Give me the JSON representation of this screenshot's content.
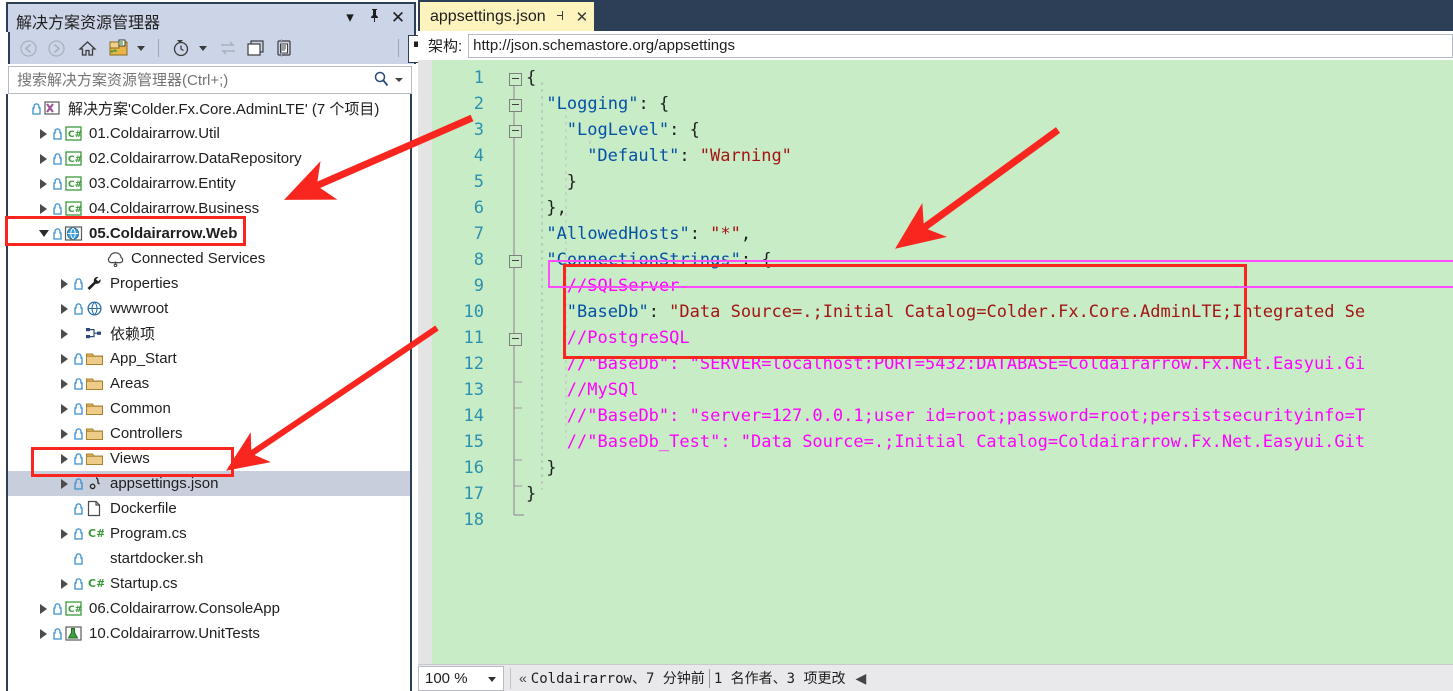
{
  "solution_explorer": {
    "title": "解决方案资源管理器",
    "header_buttons": [
      {
        "name": "dropdown",
        "glyph": "▾"
      },
      {
        "name": "pin",
        "glyph": "⇟"
      },
      {
        "name": "close",
        "glyph": "✕"
      }
    ],
    "toolbar": [
      {
        "name": "back",
        "title": "后退"
      },
      {
        "name": "forward",
        "title": "前进"
      },
      {
        "name": "home",
        "title": "主页"
      },
      {
        "name": "new-folder",
        "title": "新建文件夹"
      },
      {
        "name": "pending-changes",
        "title": "挂起的更改"
      },
      {
        "name": "sync",
        "title": "同步"
      },
      {
        "name": "properties-window",
        "title": "属性窗口"
      },
      {
        "name": "show-all-files",
        "title": "显示所有文件"
      },
      {
        "name": "view-designer",
        "title": "视图设计器"
      },
      {
        "name": "wrench",
        "title": "工具"
      },
      {
        "name": "collapse",
        "title": "全部折叠"
      }
    ],
    "search": {
      "placeholder": "搜索解决方案资源管理器(Ctrl+;)",
      "value": ""
    },
    "tree": [
      {
        "label": "解决方案'Colder.Fx.Core.AdminLTE' (7 个项目)",
        "indent": 0,
        "twisty": "none",
        "icon": "solution-icon",
        "lock": true,
        "bold": false,
        "selected": false
      },
      {
        "label": "01.Coldairarrow.Util",
        "indent": 1,
        "twisty": "right",
        "icon": "csharp-project-icon",
        "lock": true,
        "bold": false,
        "selected": false
      },
      {
        "label": "02.Coldairarrow.DataRepository",
        "indent": 1,
        "twisty": "right",
        "icon": "csharp-project-icon",
        "lock": true,
        "bold": false,
        "selected": false
      },
      {
        "label": "03.Coldairarrow.Entity",
        "indent": 1,
        "twisty": "right",
        "icon": "csharp-project-icon",
        "lock": true,
        "bold": false,
        "selected": false
      },
      {
        "label": "04.Coldairarrow.Business",
        "indent": 1,
        "twisty": "right",
        "icon": "csharp-project-icon",
        "lock": true,
        "bold": false,
        "selected": false
      },
      {
        "label": "05.Coldairarrow.Web",
        "indent": 1,
        "twisty": "down",
        "icon": "web-project-icon",
        "lock": true,
        "bold": true,
        "selected": false
      },
      {
        "label": "Connected Services",
        "indent": 3,
        "twisty": "none",
        "icon": "connected-services-icon",
        "lock": false,
        "bold": false,
        "selected": false
      },
      {
        "label": "Properties",
        "indent": 2,
        "twisty": "right",
        "icon": "properties-icon",
        "lock": true,
        "bold": false,
        "selected": false
      },
      {
        "label": "wwwroot",
        "indent": 2,
        "twisty": "right",
        "icon": "wwwroot-icon",
        "lock": true,
        "bold": false,
        "selected": false
      },
      {
        "label": "依赖项",
        "indent": 2,
        "twisty": "right",
        "icon": "dependencies-icon",
        "lock": false,
        "bold": false,
        "selected": false
      },
      {
        "label": "App_Start",
        "indent": 2,
        "twisty": "right",
        "icon": "folder-icon",
        "lock": true,
        "bold": false,
        "selected": false
      },
      {
        "label": "Areas",
        "indent": 2,
        "twisty": "right",
        "icon": "folder-icon",
        "lock": true,
        "bold": false,
        "selected": false
      },
      {
        "label": "Common",
        "indent": 2,
        "twisty": "right",
        "icon": "folder-icon",
        "lock": true,
        "bold": false,
        "selected": false
      },
      {
        "label": "Controllers",
        "indent": 2,
        "twisty": "right",
        "icon": "folder-icon",
        "lock": true,
        "bold": false,
        "selected": false
      },
      {
        "label": "Views",
        "indent": 2,
        "twisty": "right",
        "icon": "folder-icon",
        "lock": true,
        "bold": false,
        "selected": false
      },
      {
        "label": "appsettings.json",
        "indent": 2,
        "twisty": "right",
        "icon": "json-file-icon",
        "lock": true,
        "bold": false,
        "selected": true
      },
      {
        "label": "Dockerfile",
        "indent": 2,
        "twisty": "none",
        "icon": "file-icon",
        "lock": true,
        "bold": false,
        "selected": false
      },
      {
        "label": "Program.cs",
        "indent": 2,
        "twisty": "right",
        "icon": "csharp-file-icon",
        "lock": true,
        "bold": false,
        "selected": false
      },
      {
        "label": "startdocker.sh",
        "indent": 2,
        "twisty": "none",
        "icon": "blank-icon",
        "lock": true,
        "bold": false,
        "selected": false
      },
      {
        "label": "Startup.cs",
        "indent": 2,
        "twisty": "right",
        "icon": "csharp-file-icon",
        "lock": true,
        "bold": false,
        "selected": false
      },
      {
        "label": "06.Coldairarrow.ConsoleApp",
        "indent": 1,
        "twisty": "right",
        "icon": "csharp-project-icon",
        "lock": true,
        "bold": false,
        "selected": false
      },
      {
        "label": "10.Coldairarrow.UnitTests",
        "indent": 1,
        "twisty": "right",
        "icon": "test-project-icon",
        "lock": true,
        "bold": false,
        "selected": false
      }
    ]
  },
  "editor": {
    "tab": {
      "label": "appsettings.json",
      "pin_glyph": "⇥",
      "close_glyph": "✕"
    },
    "schema": {
      "label": "架构:",
      "value": "http://json.schemastore.org/appsettings"
    },
    "first_line": 1,
    "last_line": 18,
    "lines": [
      {
        "n": 1,
        "fold": true,
        "indent": 0,
        "tokens": [
          {
            "t": "{",
            "c": "p"
          }
        ]
      },
      {
        "n": 2,
        "fold": true,
        "indent": 1,
        "tokens": [
          {
            "t": "\"Logging\"",
            "c": "k"
          },
          {
            "t": ": {",
            "c": "p"
          }
        ]
      },
      {
        "n": 3,
        "fold": true,
        "indent": 2,
        "tokens": [
          {
            "t": "\"LogLevel\"",
            "c": "k"
          },
          {
            "t": ": {",
            "c": "p"
          }
        ]
      },
      {
        "n": 4,
        "fold": false,
        "indent": 3,
        "tokens": [
          {
            "t": "\"Default\"",
            "c": "k"
          },
          {
            "t": ": ",
            "c": "p"
          },
          {
            "t": "\"Warning\"",
            "c": "s"
          }
        ]
      },
      {
        "n": 5,
        "fold": false,
        "indent": 2,
        "tokens": [
          {
            "t": "}",
            "c": "p"
          }
        ]
      },
      {
        "n": 6,
        "fold": false,
        "indent": 1,
        "tokens": [
          {
            "t": "},",
            "c": "p"
          }
        ]
      },
      {
        "n": 7,
        "fold": false,
        "indent": 1,
        "tokens": [
          {
            "t": "\"AllowedHosts\"",
            "c": "k"
          },
          {
            "t": ": ",
            "c": "p"
          },
          {
            "t": "\"*\"",
            "c": "s"
          },
          {
            "t": ",",
            "c": "p"
          }
        ]
      },
      {
        "n": 8,
        "fold": true,
        "indent": 1,
        "tokens": [
          {
            "t": "\"ConnectionStrings\"",
            "c": "k"
          },
          {
            "t": ": {",
            "c": "p"
          }
        ]
      },
      {
        "n": 9,
        "fold": false,
        "indent": 2,
        "tokens": [
          {
            "t": "//SQLServer",
            "c": "c"
          }
        ]
      },
      {
        "n": 10,
        "fold": false,
        "indent": 2,
        "tokens": [
          {
            "t": "\"BaseDb\"",
            "c": "k"
          },
          {
            "t": ": ",
            "c": "p"
          },
          {
            "t": "\"Data Source=.;Initial Catalog=Colder.Fx.Core.AdminLTE;Integrated Se",
            "c": "s"
          }
        ]
      },
      {
        "n": 11,
        "fold": true,
        "indent": 2,
        "tokens": [
          {
            "t": "//PostgreSQL",
            "c": "c"
          }
        ]
      },
      {
        "n": 12,
        "fold": false,
        "indent": 2,
        "tokens": [
          {
            "t": "//\"BaseDb\": \"SERVER=localhost:PORT=5432:DATABASE=Coldairarrow.Fx.Net.Easyui.Gi",
            "c": "c"
          }
        ]
      },
      {
        "n": 13,
        "fold": false,
        "indent": 2,
        "tokens": [
          {
            "t": "//MySQl",
            "c": "c"
          }
        ]
      },
      {
        "n": 14,
        "fold": false,
        "indent": 2,
        "tokens": [
          {
            "t": "//\"BaseDb\": \"server=127.0.0.1;user id=root;password=root;persistsecurityinfo=T",
            "c": "c"
          }
        ]
      },
      {
        "n": 15,
        "fold": false,
        "indent": 2,
        "tokens": [
          {
            "t": "//\"BaseDb_Test\": \"Data Source=.;Initial Catalog=Coldairarrow.Fx.Net.Easyui.Git",
            "c": "c"
          }
        ]
      },
      {
        "n": 16,
        "fold": false,
        "indent": 1,
        "tokens": [
          {
            "t": "}",
            "c": "p"
          }
        ]
      },
      {
        "n": 17,
        "fold": false,
        "indent": 0,
        "tokens": [
          {
            "t": "}",
            "c": "p"
          }
        ]
      },
      {
        "n": 18,
        "fold": false,
        "indent": 0,
        "tokens": []
      }
    ],
    "selection_highlight_line": 9
  },
  "status_bar": {
    "zoom": "100 %",
    "git_icon": "«",
    "git_text": "Coldairarrow、7 分钟前",
    "git_authors": "1 名作者、3 项更改",
    "scroll_arrow": "◀"
  },
  "annotations": {
    "color": "#f8261e",
    "boxes": [
      {
        "name": "highlight-box-web-project"
      },
      {
        "name": "highlight-box-appsettings"
      },
      {
        "name": "highlight-box-connection-strings"
      }
    ],
    "arrows": [
      {
        "name": "arrow-to-web-project"
      },
      {
        "name": "arrow-to-appsettings"
      },
      {
        "name": "arrow-to-connection-strings"
      }
    ]
  }
}
